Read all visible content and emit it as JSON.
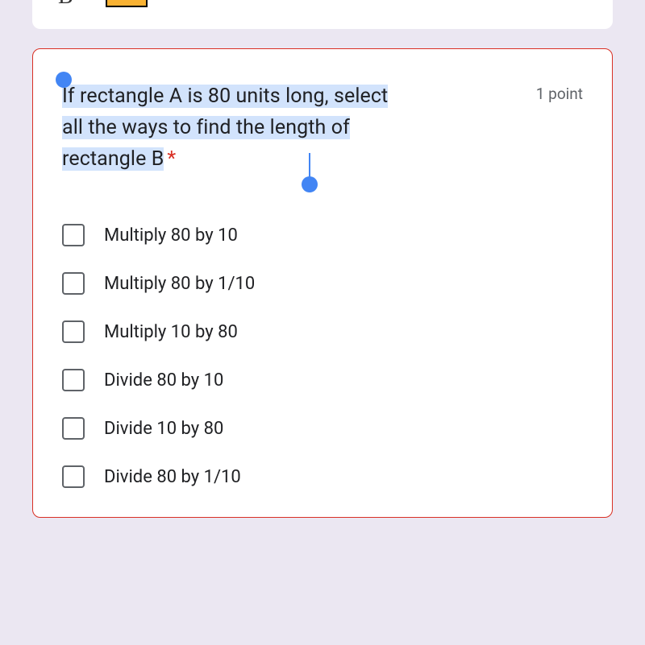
{
  "prev_card": {
    "label": "B"
  },
  "question": {
    "text": "If rectangle A is 80 units long, select all the ways to find the length of rectangle B",
    "required_marker": "*",
    "points": "1 point"
  },
  "options": [
    {
      "label": "Multiply 80 by 10"
    },
    {
      "label": "Multiply 80 by 1/10"
    },
    {
      "label": "Multiply 10 by 80"
    },
    {
      "label": "Divide 80 by 10"
    },
    {
      "label": "Divide 10 by 80"
    },
    {
      "label": "Divide 80 by 1/10"
    }
  ]
}
